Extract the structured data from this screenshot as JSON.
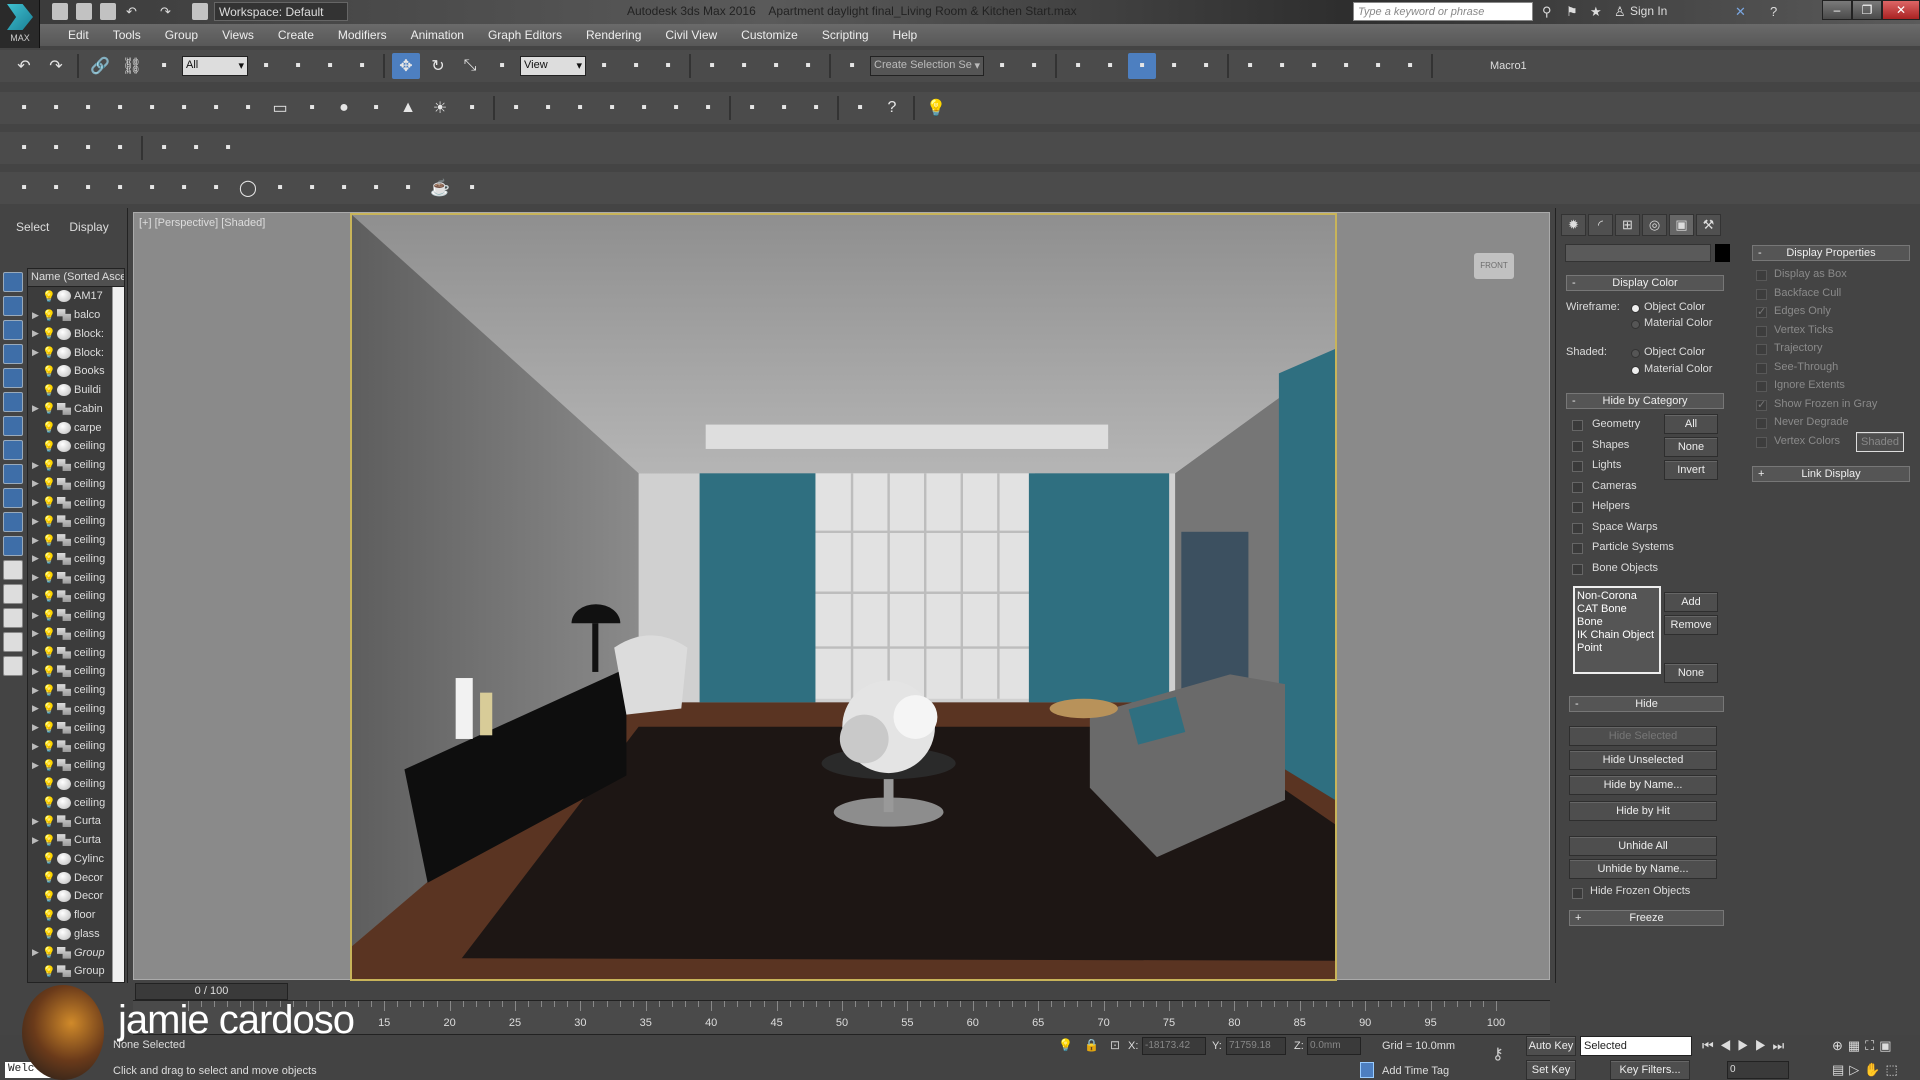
{
  "app": {
    "logo_text": "MAX",
    "workspace": "Workspace: Default",
    "title": "Autodesk 3ds Max 2016    Apartment daylight final_Living Room & Kitchen Start.max",
    "search_placeholder": "Type a keyword or phrase",
    "sign_in": "Sign In"
  },
  "menu": [
    "Edit",
    "Tools",
    "Group",
    "Views",
    "Create",
    "Modifiers",
    "Animation",
    "Graph Editors",
    "Rendering",
    "Civil View",
    "Customize",
    "Scripting",
    "Help"
  ],
  "toolbar1": [
    "undo",
    "redo",
    "|",
    "select-link",
    "unlink",
    "bind-space-warp",
    {
      "dd": "All"
    },
    "select-object",
    "select-by-name",
    "rect-selection",
    "window-crossing",
    "|",
    {
      "icon": "select-move",
      "active": true
    },
    "select-rotate",
    "select-scale",
    "select-place",
    {
      "dd": "View"
    },
    "selection-filter",
    "use-pivot",
    "select-manipulate",
    "|",
    "snaps-toggle",
    "angle-snap",
    "percent-snap",
    "spinner-snap",
    "|",
    "edit-named-selection",
    {
      "field": "Create Selection Se"
    },
    "mirror",
    "align",
    "|",
    "layer-manager",
    "scene-explorer",
    {
      "icon": "ribbon",
      "active": true
    },
    "curve-editor",
    "schematic-view",
    "|",
    "material-editor",
    "render-setup",
    "rendered-frame",
    "render",
    "render-iterative",
    "render-frame-window",
    "|",
    {
      "text": "Macro1"
    }
  ],
  "toolbar2": [
    "teapot-toggle",
    "render-frame",
    "layers",
    "grid",
    "light-lister",
    "helpers",
    "space-warps",
    "hierarchy",
    "box",
    "dome",
    "sphere",
    "bowl",
    "cone",
    "sun",
    "sphere-light",
    "|",
    "pattern",
    "link",
    "camera",
    "snowflake",
    "plant",
    "hf",
    "corona-proxy",
    "|",
    "material-sphere",
    "batch",
    "distort",
    "|",
    "scatter",
    "help",
    "|",
    "light-bulb"
  ],
  "toolbar3": [
    "fp",
    "tree",
    "tools",
    "list",
    "|",
    "rc",
    "scissors",
    "table"
  ],
  "toolbar4": [
    "light-pin",
    "sun-light",
    "multi-light",
    "forest",
    "book",
    "stairs",
    "lamp",
    "circle",
    "display",
    "grid-view",
    "frame",
    "particles",
    "crop",
    "teapot",
    "bulb"
  ],
  "left_panel": {
    "tabs": [
      "Select",
      "Display"
    ],
    "column_header": "Name (Sorted Ascer",
    "items": [
      {
        "name": "AM17",
        "exp": false,
        "icon": "sphere"
      },
      {
        "name": "balco",
        "exp": true,
        "icon": "group"
      },
      {
        "name": "Block:",
        "exp": true,
        "icon": "sphere"
      },
      {
        "name": "Block:",
        "exp": true,
        "icon": "sphere"
      },
      {
        "name": "Books",
        "exp": false,
        "icon": "sphere"
      },
      {
        "name": "Buildi",
        "exp": false,
        "icon": "sphere"
      },
      {
        "name": "Cabin",
        "exp": true,
        "icon": "group"
      },
      {
        "name": "carpe",
        "exp": false,
        "icon": "sphere"
      },
      {
        "name": "ceiling",
        "exp": false,
        "icon": "sphere"
      },
      {
        "name": "ceiling",
        "exp": true,
        "icon": "group"
      },
      {
        "name": "ceiling",
        "exp": true,
        "icon": "group"
      },
      {
        "name": "ceiling",
        "exp": true,
        "icon": "group"
      },
      {
        "name": "ceiling",
        "exp": true,
        "icon": "group"
      },
      {
        "name": "ceiling",
        "exp": true,
        "icon": "group"
      },
      {
        "name": "ceiling",
        "exp": true,
        "icon": "group"
      },
      {
        "name": "ceiling",
        "exp": true,
        "icon": "group"
      },
      {
        "name": "ceiling",
        "exp": true,
        "icon": "group"
      },
      {
        "name": "ceiling",
        "exp": true,
        "icon": "group"
      },
      {
        "name": "ceiling",
        "exp": true,
        "icon": "group"
      },
      {
        "name": "ceiling",
        "exp": true,
        "icon": "group"
      },
      {
        "name": "ceiling",
        "exp": true,
        "icon": "group"
      },
      {
        "name": "ceiling",
        "exp": true,
        "icon": "group"
      },
      {
        "name": "ceiling",
        "exp": true,
        "icon": "group"
      },
      {
        "name": "ceiling",
        "exp": true,
        "icon": "group"
      },
      {
        "name": "ceiling",
        "exp": true,
        "icon": "group"
      },
      {
        "name": "ceiling",
        "exp": true,
        "icon": "group"
      },
      {
        "name": "ceiling",
        "exp": false,
        "icon": "sphere"
      },
      {
        "name": "ceiling",
        "exp": false,
        "icon": "sphere"
      },
      {
        "name": "Curta",
        "exp": true,
        "icon": "group"
      },
      {
        "name": "Curta",
        "exp": true,
        "icon": "group"
      },
      {
        "name": "Cylinc",
        "exp": false,
        "icon": "sphere"
      },
      {
        "name": "Decor",
        "exp": false,
        "icon": "sphere"
      },
      {
        "name": "Decor",
        "exp": false,
        "icon": "sphere"
      },
      {
        "name": "floor",
        "exp": false,
        "icon": "sphere"
      },
      {
        "name": "glass",
        "exp": false,
        "icon": "sphere"
      },
      {
        "name": "Group",
        "exp": true,
        "icon": "group",
        "italic": true
      },
      {
        "name": "Group",
        "exp": false,
        "icon": "group"
      }
    ]
  },
  "viewport": {
    "label": "[+] [Perspective] [Shaded]",
    "viewcube": "FRONT"
  },
  "command_panel": {
    "tabs": [
      "create",
      "modify",
      "hierarchy",
      "motion",
      "display",
      "utilities"
    ],
    "display_color": {
      "title": "Display Color",
      "wireframe_label": "Wireframe:",
      "shaded_label": "Shaded:",
      "object_color": "Object Color",
      "material_color": "Material Color"
    },
    "hide_by_category": {
      "title": "Hide by Category",
      "items": [
        "Geometry",
        "Shapes",
        "Lights",
        "Cameras",
        "Helpers",
        "Space Warps",
        "Particle Systems",
        "Bone Objects"
      ],
      "buttons": [
        "All",
        "None",
        "Invert"
      ],
      "list": [
        "Non-Corona",
        "CAT Bone",
        "Bone",
        "IK Chain Object",
        "Point"
      ],
      "add": "Add",
      "remove": "Remove",
      "none": "None"
    },
    "hide": {
      "title": "Hide",
      "buttons": [
        "Hide Selected",
        "Hide Unselected",
        "Hide by Name...",
        "Hide by Hit",
        "Unhide All",
        "Unhide by Name..."
      ],
      "hide_frozen": "Hide Frozen Objects"
    },
    "freeze": {
      "title": "Freeze"
    },
    "display_properties": {
      "title": "Display Properties",
      "items": [
        {
          "label": "Display as Box",
          "checked": false
        },
        {
          "label": "Backface Cull",
          "checked": false
        },
        {
          "label": "Edges Only",
          "checked": true
        },
        {
          "label": "Vertex Ticks",
          "checked": false
        },
        {
          "label": "Trajectory",
          "checked": false
        },
        {
          "label": "See-Through",
          "checked": false
        },
        {
          "label": "Ignore Extents",
          "checked": false
        },
        {
          "label": "Show Frozen in Gray",
          "checked": true
        },
        {
          "label": "Never Degrade",
          "checked": false
        },
        {
          "label": "Vertex Colors",
          "checked": false
        }
      ],
      "shaded": "Shaded"
    },
    "link_display": {
      "title": "Link Display"
    }
  },
  "timeline": {
    "slider": "0 / 100",
    "labels": [
      15,
      20,
      25,
      30,
      35,
      40,
      45,
      50,
      55,
      60,
      65,
      70,
      75,
      80,
      85,
      90,
      95,
      100
    ]
  },
  "status": {
    "selection": "None Selected",
    "prompt": "Click and drag to select and move objects",
    "x_label": "X:",
    "x": "-18173.42",
    "y_label": "Y:",
    "y": "71759.18",
    "z_label": "Z:",
    "z": "0.0mm",
    "grid": "Grid = 10.0mm",
    "add_time_tag": "Add Time Tag",
    "auto_key": "Auto Key",
    "set_key": "Set Key",
    "key_mode": "Selected",
    "key_filters": "Key Filters...",
    "frame": "0",
    "listener": "Welc"
  },
  "overlay": {
    "presenter": "jamie cardoso"
  },
  "colors": {
    "accent": "#4d7fc0",
    "curtain": "#2f6f80",
    "viewport_border": "#c8b45a"
  }
}
